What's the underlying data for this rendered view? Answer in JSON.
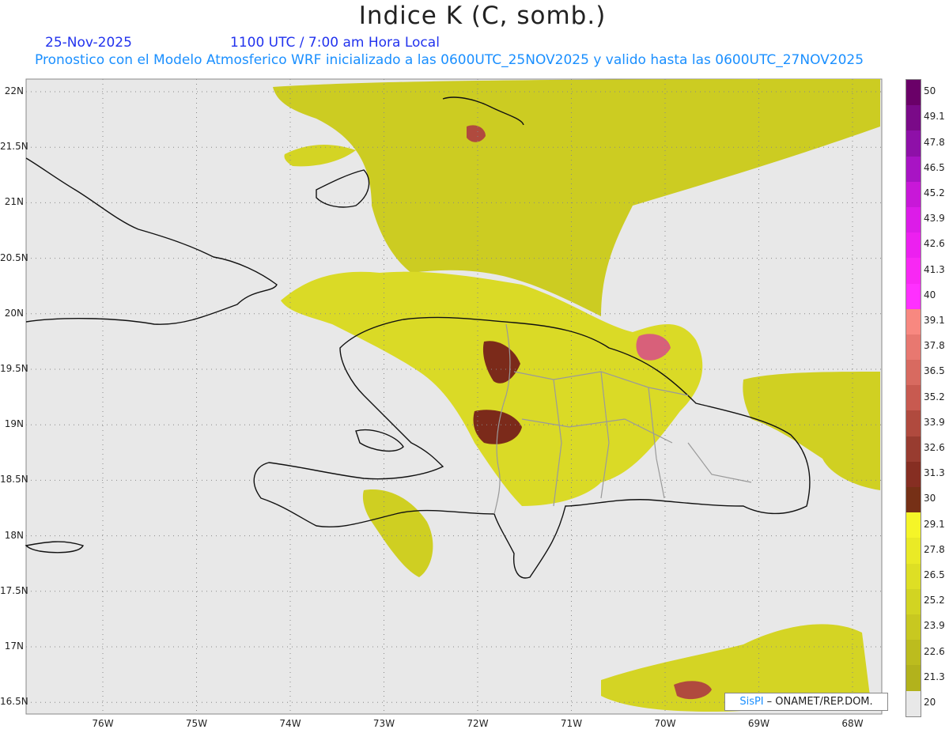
{
  "header": {
    "title": "Indice K (C, somb.)",
    "date": "25-Nov-2025",
    "time": "1100 UTC / 7:00 am Hora Local",
    "subtitle": "Pronostico con el Modelo Atmosferico WRF inicializado a las 0600UTC_25NOV2025 y valido hasta las  0600UTC_27NOV2025"
  },
  "map": {
    "lat_labels": [
      "22N",
      "21.5N",
      "21N",
      "20.5N",
      "20N",
      "19.5N",
      "19N",
      "18.5N",
      "18N",
      "17.5N",
      "17N",
      "16.5N"
    ],
    "lon_labels": [
      "76W",
      "75W",
      "74W",
      "73W",
      "72W",
      "71W",
      "70W",
      "69W",
      "68W"
    ],
    "background_color": "#e8e8e8"
  },
  "legend": {
    "labels": [
      "50",
      "49.1",
      "47.8",
      "46.5",
      "45.2",
      "43.9",
      "42.6",
      "41.3",
      "40",
      "39.1",
      "37.8",
      "36.5",
      "35.2",
      "33.9",
      "32.6",
      "31.3",
      "30",
      "29.1",
      "27.8",
      "26.5",
      "25.2",
      "23.9",
      "22.6",
      "21.3",
      "20"
    ],
    "colors": [
      "#6a0068",
      "#7a0a88",
      "#8e10a8",
      "#a814c4",
      "#c818d8",
      "#dc1ce8",
      "#ec20f0",
      "#f828f4",
      "#ff30ff",
      "#f88880",
      "#e87870",
      "#d86a60",
      "#c85a50",
      "#b04a3e",
      "#983c30",
      "#862e22",
      "#763016",
      "#f5f528",
      "#eaea26",
      "#dedf24",
      "#d2d422",
      "#c8c820",
      "#bcbc1e",
      "#b2b21c",
      "#e8e8e8"
    ]
  },
  "credit": {
    "brand": "SisPI",
    "text": "–  ONAMET/REP.DOM."
  }
}
